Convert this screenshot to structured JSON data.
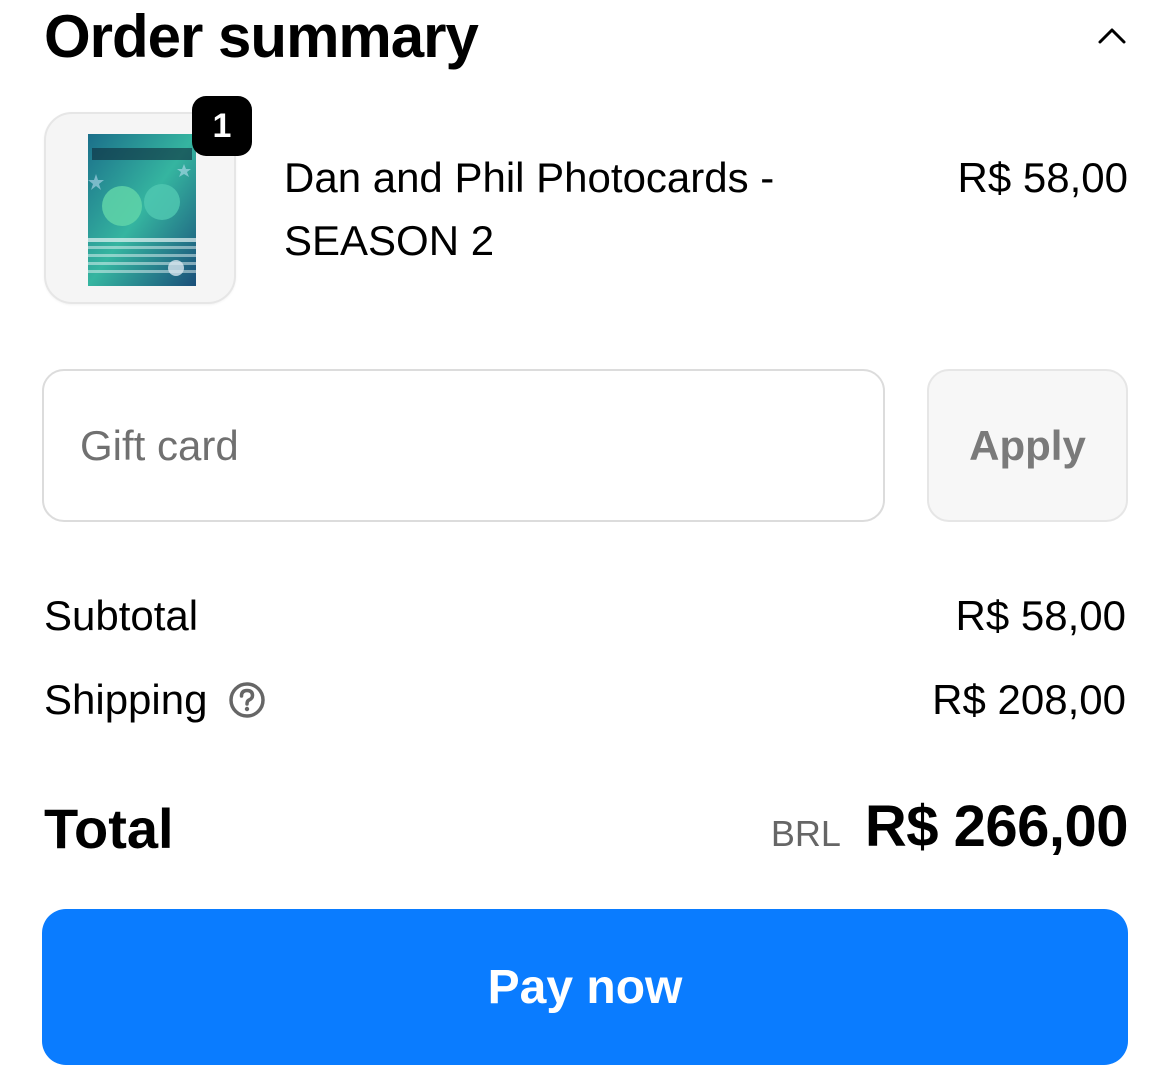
{
  "header": {
    "title": "Order summary",
    "toggle_icon": "chevron-up-icon"
  },
  "item": {
    "quantity": "1",
    "name": "Dan and Phil Photocards - SEASON 2",
    "price": "R$ 58,00",
    "image": "photocard-pack-thumbnail"
  },
  "gift_card": {
    "placeholder": "Gift card",
    "value": "",
    "apply_label": "Apply"
  },
  "summary": {
    "subtotal_label": "Subtotal",
    "subtotal_value": "R$ 58,00",
    "shipping_label": "Shipping",
    "shipping_help_icon": "question-circle-icon",
    "shipping_value": "R$ 208,00"
  },
  "total": {
    "label": "Total",
    "currency": "BRL",
    "amount": "R$ 266,00"
  },
  "pay": {
    "label": "Pay now"
  },
  "colors": {
    "pay_button": "#0a7cff",
    "badge": "#000000",
    "muted_text": "#707070"
  }
}
